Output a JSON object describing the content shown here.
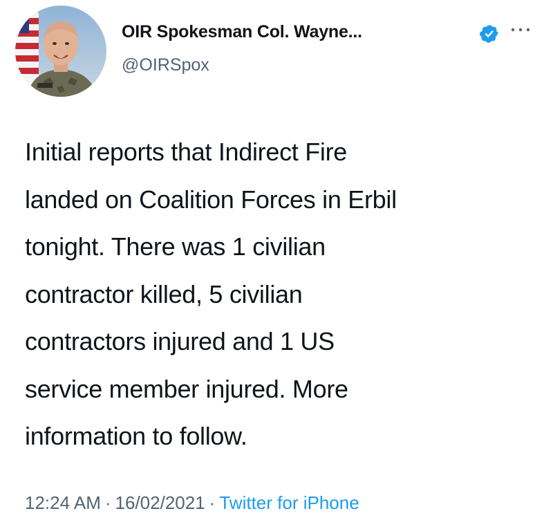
{
  "author": {
    "display_name": "OIR Spokesman Col. Wayne...",
    "handle": "@OIRSpox",
    "verified": true
  },
  "tweet": {
    "lines": [
      "Initial reports that Indirect Fire",
      "landed on Coalition Forces in Erbil",
      "tonight. There was 1 civilian",
      "contractor killed, 5 civilian",
      "contractors injured and 1 US",
      "service member injured. More",
      "information to follow."
    ]
  },
  "meta": {
    "time": "12:24 AM",
    "separator": "·",
    "date": "16/02/2021",
    "source": "Twitter for iPhone"
  },
  "icons": {
    "verified": "verified-badge-icon",
    "more": "more-options-icon"
  },
  "colors": {
    "verified_blue": "#1d9bf0",
    "link_blue": "#1d9bf0",
    "secondary_text": "#536471",
    "primary_text": "#0f1419"
  }
}
